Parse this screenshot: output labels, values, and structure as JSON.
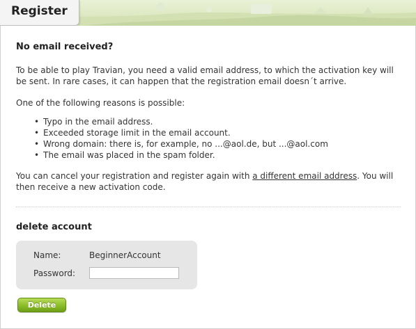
{
  "header": {
    "title": "Register"
  },
  "intro": {
    "heading": "No email received?",
    "paragraph1": "To be able to play Travian, you need a valid email address, to which the activation key will be sent. In rare cases, it can happen that the registration email doesn´t arrive.",
    "paragraph2": "One of the following reasons is possible:",
    "reasons": [
      "Typo in the email address.",
      "Exceeded storage limit in the email account.",
      "Wrong domain: there is, for example, no ...@aol.de, but ...@aol.com",
      "The email was placed in the spam folder."
    ],
    "paragraph3_before": "You can cancel your registration and register again with ",
    "paragraph3_link": "a different email address",
    "paragraph3_after": ". You will then receive a new activation code."
  },
  "delete_account": {
    "heading": "delete account",
    "name_label": "Name:",
    "name_value": "BeginnerAccount",
    "password_label": "Password:",
    "password_value": "",
    "delete_label": "Delete"
  },
  "colors": {
    "header_bg": "#dfe9c4",
    "button_green": "#8ebf2b",
    "form_bg": "#e6e6e6"
  }
}
